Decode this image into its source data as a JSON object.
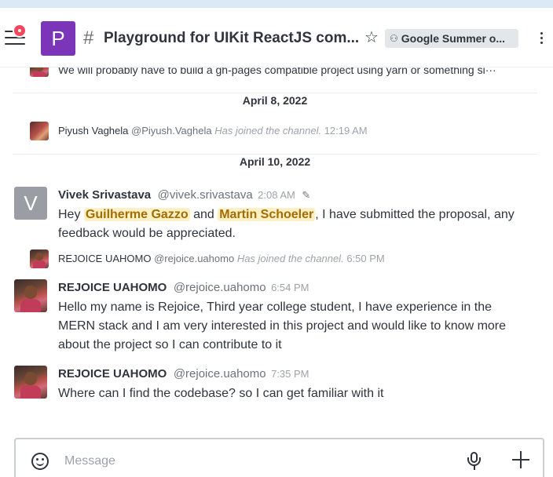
{
  "header": {
    "room_avatar_letter": "P",
    "room_title": "Playground for UIKit ReactJS com...",
    "team_name": "Google Summer o..."
  },
  "messages": {
    "cutoff_text": "We will probably have to build a gh-pages compatible project using yarn or something si···",
    "date_1": "April 8, 2022",
    "piyush": {
      "name": "Piyush Vaghela",
      "handle": "@Piyush.Vaghela",
      "action": "Has joined the channel.",
      "time": "12:19 AM"
    },
    "date_2": "April 10, 2022",
    "vivek": {
      "avatar_letter": "V",
      "name": "Vivek Srivastava",
      "handle": "@vivek.srivastava",
      "time": "2:08 AM",
      "text_1": "Hey",
      "mention_1": "Guilherme Gazzo",
      "text_2": "and",
      "mention_2": "Martin Schoeler",
      "text_3": ", I have submitted the proposal, any feedback would be appreciated."
    },
    "rejoice_join": {
      "name": "REJOICE UAHOMO",
      "handle": "@rejoice.uahomo",
      "action": "Has joined the channel.",
      "time": "6:50 PM"
    },
    "rejoice_msg1": {
      "name": "REJOICE UAHOMO",
      "handle": "@rejoice.uahomo",
      "time": "6:54 PM",
      "text": "Hello my name is Rejoice, Third year college student, I have experience in the MERN stack and I am very interested in this project and would like to know more about the project so I can contribute to it"
    },
    "rejoice_msg2": {
      "name": "REJOICE UAHOMO",
      "handle": "@rejoice.uahomo",
      "time": "7:35 PM",
      "text": "Where can I find the codebase? so I can get familiar with it"
    }
  },
  "composer": {
    "placeholder": "Message"
  },
  "icons": {
    "hamburger": "hamburger-menu-icon",
    "hash": "hash-icon",
    "star": "star-icon",
    "team": "team-icon",
    "kebab": "kebab-menu-icon",
    "edit": "pencil-icon",
    "emoji": "emoji-icon",
    "mic": "microphone-icon",
    "plus": "plus-icon"
  },
  "colors": {
    "room_avatar": "#7a35b8",
    "badge": "#f5455c",
    "mention_bg": "#fdf0c4",
    "mention_text": "#a36c00"
  }
}
